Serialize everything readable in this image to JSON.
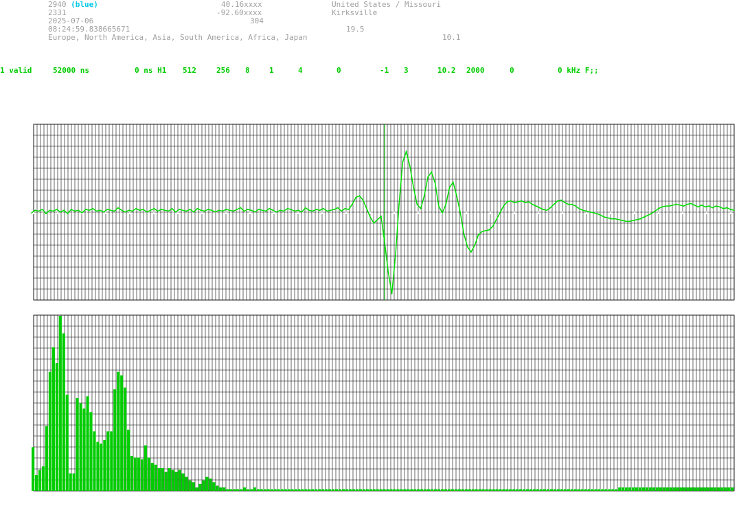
{
  "header": {
    "station_id": "2940",
    "station_color_label": "(blue)",
    "row2_id": "2331",
    "date": "2025-07-06",
    "time": "08:24:59.838665671",
    "regions": "Europe, North America, Asia, South America, Africa, Japan",
    "latitude": "40.16xxxx",
    "longitude": "-92.60xxxx",
    "altitude": "304",
    "location_country": "United States / Missouri",
    "location_city": "Kirksville",
    "value_a": "19.5",
    "value_b": "10.1"
  },
  "status": {
    "f1": "1 valid",
    "f2": "52000 ns",
    "f3": "0 ns H1",
    "f4": "512",
    "f5": "256",
    "f6": "8",
    "f7": "1",
    "f8": "4",
    "f9": "0",
    "f10": "-1",
    "f11": "3",
    "f12": "10.2",
    "f13": "2000",
    "f14": "0",
    "f15": "0 kHz F;;"
  },
  "colors": {
    "signal": "#00dd00",
    "bars": "#00cc00",
    "grid": "#000000",
    "cyan": "#00c8e8",
    "text": "#a0a0a0"
  },
  "chart_data": [
    {
      "type": "line",
      "name": "waveform",
      "ylim": [
        -1,
        1
      ],
      "trigger_index": 98,
      "values": [
        0.0,
        0.03,
        0.02,
        0.04,
        -0.01,
        0.03,
        0.02,
        0.04,
        0.01,
        0.03,
        -0.01,
        0.04,
        0.02,
        0.03,
        0.0,
        0.04,
        0.03,
        0.05,
        0.02,
        0.03,
        0.01,
        0.04,
        0.03,
        0.02,
        0.06,
        0.03,
        0.01,
        0.03,
        0.02,
        0.05,
        0.03,
        0.04,
        0.01,
        0.03,
        0.05,
        0.02,
        0.04,
        0.03,
        0.02,
        0.05,
        0.01,
        0.04,
        0.03,
        0.02,
        0.04,
        0.01,
        0.05,
        0.03,
        0.02,
        0.04,
        0.03,
        0.01,
        0.03,
        0.02,
        0.04,
        0.03,
        0.02,
        0.04,
        0.06,
        0.02,
        0.04,
        0.03,
        0.01,
        0.04,
        0.03,
        0.02,
        0.05,
        0.03,
        0.01,
        0.03,
        0.02,
        0.05,
        0.04,
        0.02,
        0.03,
        0.01,
        0.06,
        0.03,
        0.02,
        0.04,
        0.03,
        0.05,
        0.02,
        0.03,
        0.04,
        0.06,
        0.02,
        0.05,
        0.04,
        0.1,
        0.18,
        0.2,
        0.15,
        0.05,
        -0.05,
        -0.12,
        -0.08,
        -0.04,
        -0.35,
        -0.7,
        -0.95,
        -0.5,
        0.1,
        0.6,
        0.72,
        0.55,
        0.3,
        0.1,
        0.05,
        0.2,
        0.42,
        0.48,
        0.35,
        0.08,
        0.0,
        0.1,
        0.3,
        0.36,
        0.2,
        0.0,
        -0.25,
        -0.4,
        -0.46,
        -0.38,
        -0.26,
        -0.22,
        -0.21,
        -0.2,
        -0.16,
        -0.08,
        0.0,
        0.08,
        0.13,
        0.14,
        0.12,
        0.13,
        0.14,
        0.12,
        0.13,
        0.1,
        0.08,
        0.06,
        0.04,
        0.03,
        0.06,
        0.1,
        0.14,
        0.15,
        0.12,
        0.1,
        0.1,
        0.08,
        0.05,
        0.03,
        0.02,
        0.01,
        0.0,
        -0.01,
        -0.03,
        -0.05,
        -0.06,
        -0.07,
        -0.07,
        -0.08,
        -0.09,
        -0.1,
        -0.1,
        -0.09,
        -0.08,
        -0.07,
        -0.05,
        -0.03,
        -0.01,
        0.02,
        0.05,
        0.07,
        0.08,
        0.08,
        0.09,
        0.1,
        0.09,
        0.08,
        0.1,
        0.11,
        0.09,
        0.07,
        0.09,
        0.07,
        0.08,
        0.06,
        0.08,
        0.07,
        0.05,
        0.06,
        0.04,
        0.03
      ]
    },
    {
      "type": "bar",
      "name": "spectrum",
      "ylim": [
        0,
        1
      ],
      "values": [
        0.25,
        0.09,
        0.12,
        0.14,
        0.37,
        0.68,
        0.82,
        0.73,
        1.0,
        0.9,
        0.55,
        0.1,
        0.1,
        0.53,
        0.5,
        0.47,
        0.54,
        0.45,
        0.34,
        0.28,
        0.27,
        0.29,
        0.34,
        0.34,
        0.58,
        0.68,
        0.66,
        0.59,
        0.35,
        0.2,
        0.19,
        0.19,
        0.18,
        0.26,
        0.19,
        0.16,
        0.15,
        0.13,
        0.13,
        0.11,
        0.13,
        0.12,
        0.11,
        0.12,
        0.1,
        0.08,
        0.06,
        0.05,
        0.02,
        0.04,
        0.06,
        0.08,
        0.07,
        0.05,
        0.03,
        0.02,
        0.02,
        0.01,
        0.01,
        0.01,
        0.01,
        0.01,
        0.02,
        0.01,
        0.01,
        0.02,
        0.01,
        0.01,
        0.01,
        0.01,
        0.01,
        0.01,
        0.01,
        0.01,
        0.01,
        0.01,
        0.01,
        0.01,
        0.01,
        0.01,
        0.01,
        0.01,
        0.01,
        0.01,
        0.01,
        0.01,
        0.01,
        0.01,
        0.01,
        0.01,
        0.01,
        0.01,
        0.01,
        0.01,
        0.01,
        0.01,
        0.01,
        0.01,
        0.01,
        0.01,
        0.01,
        0.01,
        0.01,
        0.01,
        0.01,
        0.01,
        0.01,
        0.01,
        0.01,
        0.01,
        0.01,
        0.01,
        0.01,
        0.01,
        0.01,
        0.01,
        0.01,
        0.01,
        0.01,
        0.01,
        0.01,
        0.01,
        0.01,
        0.01,
        0.01,
        0.01,
        0.01,
        0.01,
        0.01,
        0.01,
        0.01,
        0.01,
        0.01,
        0.01,
        0.01,
        0.01,
        0.01,
        0.01,
        0.01,
        0.01,
        0.01,
        0.01,
        0.01,
        0.01,
        0.01,
        0.01,
        0.01,
        0.01,
        0.01,
        0.01,
        0.01,
        0.01,
        0.01,
        0.01,
        0.01,
        0.01,
        0.01,
        0.01,
        0.01,
        0.01,
        0.01,
        0.01,
        0.01,
        0.01,
        0.01,
        0.01,
        0.01,
        0.01,
        0.01,
        0.01,
        0.01,
        0.01,
        0.02,
        0.02,
        0.02,
        0.02,
        0.02,
        0.02,
        0.02,
        0.02,
        0.02,
        0.02,
        0.02,
        0.02,
        0.02,
        0.02,
        0.02,
        0.02,
        0.02,
        0.02,
        0.02,
        0.02,
        0.02,
        0.02,
        0.02,
        0.02,
        0.02,
        0.02,
        0.02,
        0.02,
        0.02,
        0.02,
        0.02,
        0.02,
        0.02,
        0.02
      ]
    }
  ]
}
